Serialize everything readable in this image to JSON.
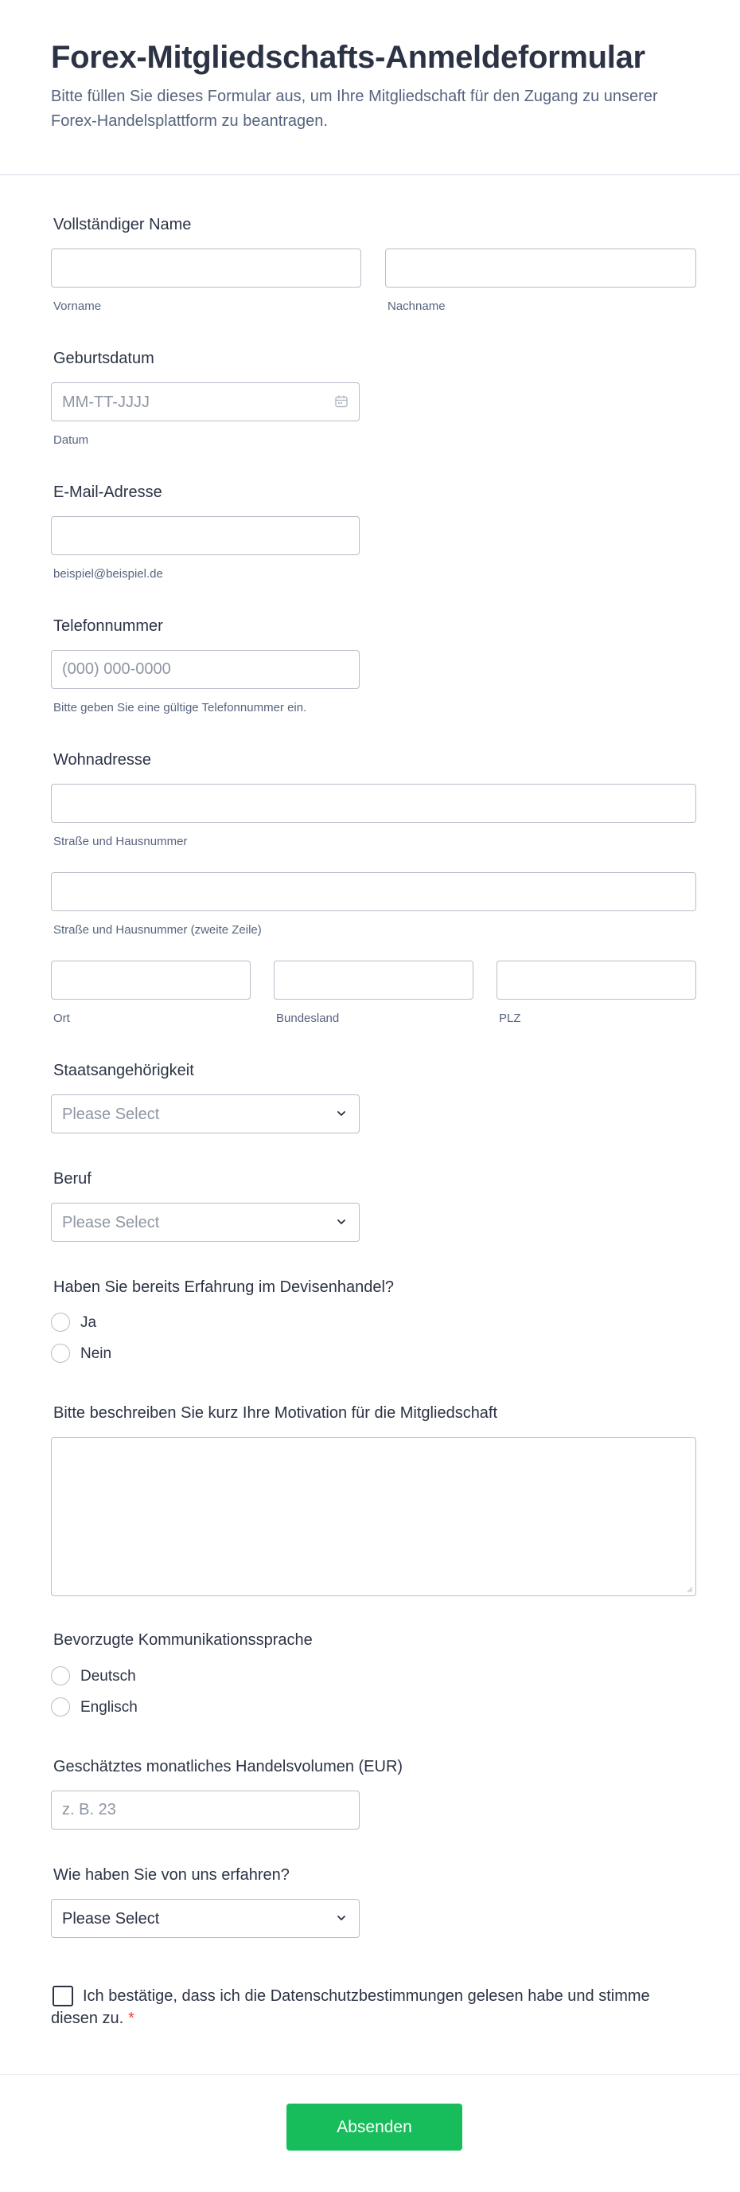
{
  "header": {
    "title": "Forex-Mitgliedschafts-Anmeldeformular",
    "subtitle": "Bitte füllen Sie dieses Formular aus, um Ihre Mitgliedschaft für den Zugang zu unserer Forex-Handelsplattform zu beantragen."
  },
  "full_name": {
    "label": "Vollständiger Name",
    "first_sublabel": "Vorname",
    "last_sublabel": "Nachname"
  },
  "birthdate": {
    "label": "Geburtsdatum",
    "placeholder": "MM-TT-JJJJ",
    "sublabel": "Datum"
  },
  "email": {
    "label": "E-Mail-Adresse",
    "sublabel": "beispiel@beispiel.de"
  },
  "phone": {
    "label": "Telefonnummer",
    "placeholder": "(000) 000-0000",
    "sublabel": "Bitte geben Sie eine gültige Telefonnummer ein."
  },
  "address": {
    "label": "Wohnadresse",
    "street_sublabel": "Straße und Hausnummer",
    "street2_sublabel": "Straße und Hausnummer (zweite Zeile)",
    "city_sublabel": "Ort",
    "state_sublabel": "Bundesland",
    "zip_sublabel": "PLZ"
  },
  "nationality": {
    "label": "Staatsangehörigkeit",
    "value": "Please Select"
  },
  "occupation": {
    "label": "Beruf",
    "value": "Please Select"
  },
  "experience": {
    "label": "Haben Sie bereits Erfahrung im Devisenhandel?",
    "options": [
      "Ja",
      "Nein"
    ]
  },
  "motivation": {
    "label": "Bitte beschreiben Sie kurz Ihre Motivation für die Mitgliedschaft"
  },
  "language": {
    "label": "Bevorzugte Kommunikationssprache",
    "options": [
      "Deutsch",
      "Englisch"
    ]
  },
  "volume": {
    "label": "Geschätztes monatliches Handelsvolumen (EUR)",
    "placeholder": "z. B. 23"
  },
  "referral": {
    "label": "Wie haben Sie von uns erfahren?",
    "value": "Please Select"
  },
  "consent": {
    "text": "Ich bestätige, dass ich die Datenschutzbestimmungen gelesen habe und stimme diesen zu.",
    "required_mark": "*"
  },
  "submit": {
    "label": "Absenden"
  },
  "colors": {
    "text": "#2c3345",
    "muted": "#57647e",
    "border": "#b8bdc9",
    "submit": "#18bd5b",
    "required": "#f23a3c"
  }
}
